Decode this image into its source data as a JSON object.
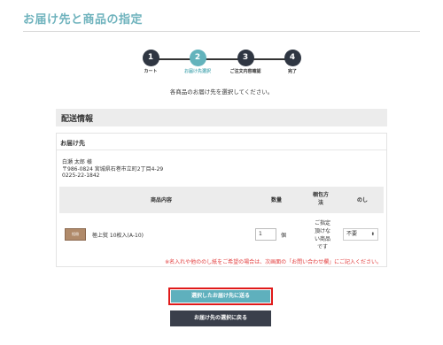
{
  "page": {
    "title": "お届け先と商品の指定"
  },
  "steps": [
    {
      "num": "1",
      "label": "カート",
      "active": false
    },
    {
      "num": "2",
      "label": "お届け先選択",
      "active": true
    },
    {
      "num": "3",
      "label": "ご注文内容確認",
      "active": false
    },
    {
      "num": "4",
      "label": "完了",
      "active": false
    }
  ],
  "instruction": "各商品のお届け先を選択してください。",
  "shipping": {
    "heading": "配送情報",
    "destination_label": "お届け先",
    "recipient_name": "白瀬 太郎 様",
    "address": "〒986-0824 宮城県石巻市立町2丁目4-29",
    "phone": "0225-22-1842"
  },
  "table": {
    "headers": {
      "item": "商品内容",
      "qty": "数量",
      "packing_1": "梱包方",
      "packing_2": "法",
      "noshi": "のし"
    },
    "row": {
      "thumb_text": "短冊",
      "name": "極上熨 10枚入(A-10)",
      "qty": "1",
      "unit": "個",
      "packing_lines": [
        "ご指定",
        "頂けな",
        "い商品",
        "です"
      ],
      "noshi_selected": "不要",
      "noshi_arrow": "⬍"
    }
  },
  "note": "※名入れや他ののし紙をご希望の場合は、次画面の「お問い合わせ欄」にご記入ください。",
  "buttons": {
    "primary": "選択したお届け先に送る",
    "secondary": "お届け先の選択に戻る"
  },
  "colors": {
    "accent": "#5fb0bd",
    "dark": "#2f3642",
    "highlight": "#e01a1a",
    "note": "#e23c3c"
  }
}
